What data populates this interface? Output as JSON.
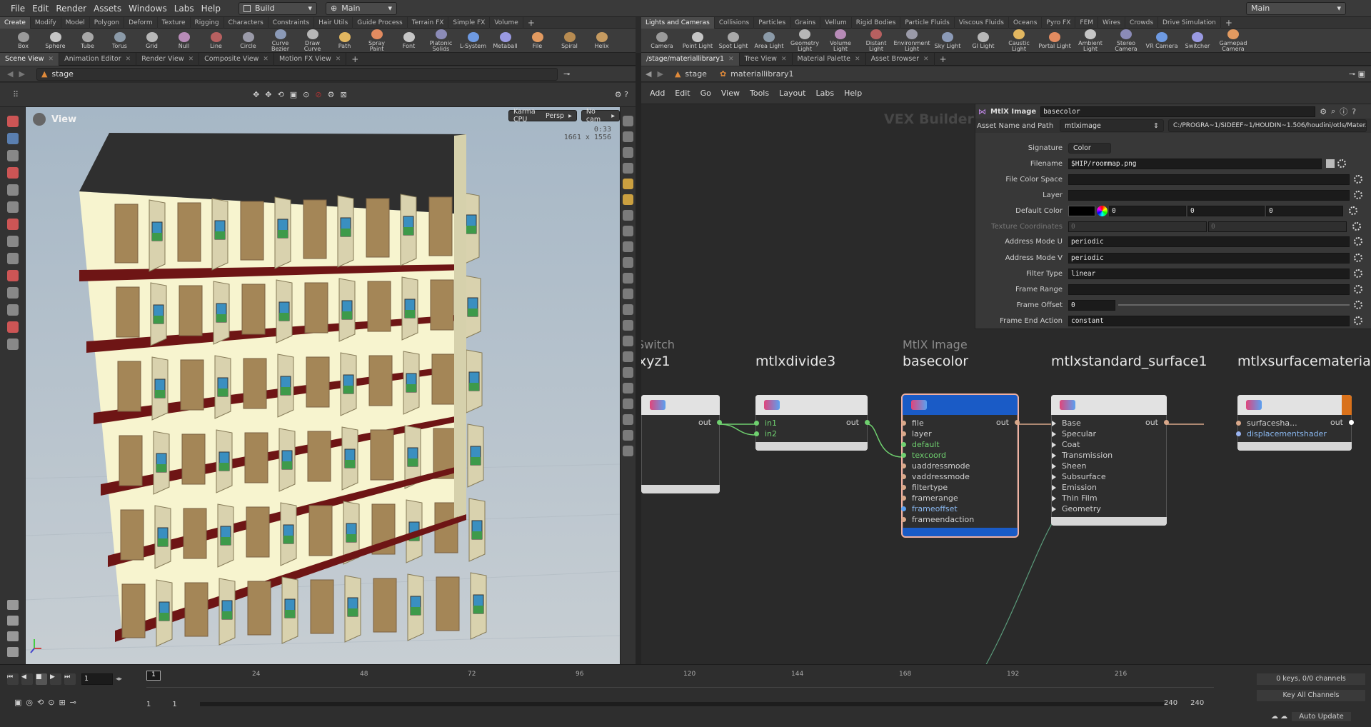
{
  "menu": [
    "File",
    "Edit",
    "Render",
    "Assets",
    "Windows",
    "Labs",
    "Help"
  ],
  "desktop": "Build",
  "context": "Main",
  "main_right": "Main",
  "left_shelf_tabs": [
    "Create",
    "Modify",
    "Model",
    "Polygon",
    "Deform",
    "Texture",
    "Rigging",
    "Characters",
    "Constraints",
    "Hair Utils",
    "Guide Process",
    "Terrain FX",
    "Simple FX",
    "Volume"
  ],
  "left_tools": [
    "Box",
    "Sphere",
    "Tube",
    "Torus",
    "Grid",
    "Null",
    "Line",
    "Circle",
    "Curve Bezier",
    "Draw Curve",
    "Path",
    "Spray Paint",
    "Font",
    "Platonic Solids",
    "L-System",
    "Metaball",
    "File",
    "Spiral",
    "Helix"
  ],
  "right_shelf_tabs": [
    "Lights and Cameras",
    "Collisions",
    "Particles",
    "Grains",
    "Vellum",
    "Rigid Bodies",
    "Particle Fluids",
    "Viscous Fluids",
    "Oceans",
    "Pyro FX",
    "FEM",
    "Wires",
    "Crowds",
    "Drive Simulation"
  ],
  "right_tools": [
    "Camera",
    "Point Light",
    "Spot Light",
    "Area Light",
    "Geometry Light",
    "Volume Light",
    "Distant Light",
    "Environment Light",
    "Sky Light",
    "GI Light",
    "Caustic Light",
    "Portal Light",
    "Ambient Light",
    "Stereo Camera",
    "VR Camera",
    "Switcher",
    "Gamepad Camera"
  ],
  "left_pane_tabs": [
    "Scene View",
    "Animation Editor",
    "Render View",
    "Composite View",
    "Motion FX View"
  ],
  "right_pane_tabs": [
    "/stage/materiallibrary1",
    "Tree View",
    "Material Palette",
    "Asset Browser"
  ],
  "left_path": "stage",
  "right_path": [
    "stage",
    "materiallibrary1"
  ],
  "viewport": {
    "label": "View",
    "renderer": "Karma CPU",
    "persp": "Persp",
    "cam": "No cam",
    "time": "0:33",
    "res": "1661 x 1556"
  },
  "net_menu": [
    "Add",
    "Edit",
    "Go",
    "View",
    "Tools",
    "Layout",
    "Labs",
    "Help"
  ],
  "network_label": "VEX Builder",
  "parms": {
    "type_label": "MtlX Image",
    "node_name": "basecolor",
    "asset_label": "Asset Name and Path",
    "asset_name": "mtlximage",
    "asset_path": "C:/PROGRA~1/SIDEEF~1/HOUDIN~1.506/houdini/otls/Mater...",
    "rows": [
      {
        "label": "Signature",
        "value": "Color"
      },
      {
        "label": "Filename",
        "value": "$HIP/roommap.png"
      },
      {
        "label": "File Color Space",
        "value": ""
      },
      {
        "label": "Layer",
        "value": ""
      },
      {
        "label": "Default Color",
        "value": "0",
        "v2": "0",
        "v3": "0"
      },
      {
        "label": "Texture Coordinates",
        "value": "0",
        "v2": "0"
      },
      {
        "label": "Address Mode U",
        "value": "periodic"
      },
      {
        "label": "Address Mode V",
        "value": "periodic"
      },
      {
        "label": "Filter Type",
        "value": "linear"
      },
      {
        "label": "Frame Range",
        "value": ""
      },
      {
        "label": "Frame Offset",
        "value": "0"
      },
      {
        "label": "Frame End Action",
        "value": "constant"
      }
    ]
  },
  "nodes": {
    "n0": {
      "sub": "Switch",
      "name": "xyz1",
      "out": "out"
    },
    "n1": {
      "name": "mtlxdivide3",
      "inputs": [
        "in1",
        "in2"
      ],
      "out": "out"
    },
    "n2": {
      "sub": "MtlX Image",
      "name": "basecolor",
      "inputs": [
        "file",
        "layer",
        "default",
        "texcoord",
        "uaddressmode",
        "vaddressmode",
        "filtertype",
        "framerange",
        "frameoffset",
        "frameendaction"
      ],
      "out": "out"
    },
    "n3": {
      "name": "mtlxstandard_surface1",
      "inputs": [
        "Base",
        "Specular",
        "Coat",
        "Transmission",
        "Sheen",
        "Subsurface",
        "Emission",
        "Thin Film",
        "Geometry"
      ],
      "out": "out"
    },
    "n4": {
      "name": "mtlxsurfacematerial",
      "inputs": [
        "surfacesha...",
        "displacementshader"
      ],
      "out": "out"
    }
  },
  "timeline": {
    "ticks": [
      "24",
      "48",
      "72",
      "96",
      "120",
      "144",
      "168",
      "192",
      "216"
    ],
    "frame": "1",
    "start": "1",
    "start2": "1",
    "end": "240",
    "end2": "240",
    "marker": "1"
  },
  "status": {
    "keys": "0 keys, 0/0 channels",
    "keyall": "Key All Channels",
    "auto": "Auto Update"
  }
}
